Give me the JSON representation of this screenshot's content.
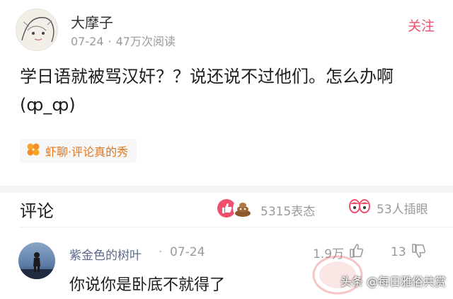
{
  "post": {
    "author": "大摩子",
    "date": "07-24",
    "views": "47万次阅读",
    "follow_label": "关注",
    "content": "学日语就被骂汉奸？？说还说不过他们。怎么办啊(ȹ_ȹ)",
    "topic": "虾聊·评论真的秀"
  },
  "comments_section": {
    "title": "评论",
    "reaction_count": "5315表态",
    "eye_count": "53人插眼"
  },
  "comments": [
    {
      "author": "紫金色的树叶",
      "date": "07-24",
      "likes": "1.9万",
      "dislikes": "13",
      "text": "你说你是卧底不就得了"
    }
  ],
  "watermark": "头条 @每日雅俗共赏",
  "colors": {
    "follow": "#f0506e",
    "topic": "#e0761c",
    "commenter": "#5b6b8a"
  }
}
